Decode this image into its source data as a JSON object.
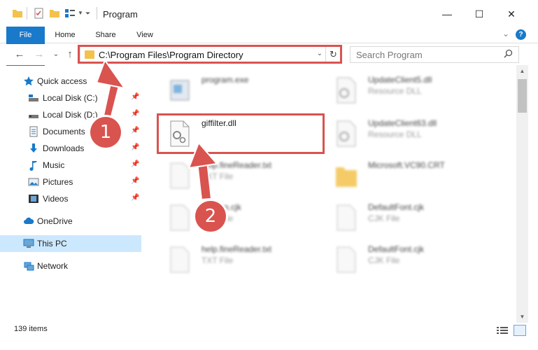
{
  "window": {
    "title": "Program",
    "minimize": "—",
    "maximize": "☐",
    "close": "✕"
  },
  "ribbon": {
    "tabs": [
      "File",
      "Home",
      "Share",
      "View"
    ],
    "help": "?"
  },
  "address": {
    "path": "C:\\Program Files\\Program Directory",
    "search_placeholder": "Search Program"
  },
  "sidebar": {
    "items": [
      {
        "label": "Quick access",
        "icon": "star-icon"
      },
      {
        "label": "Local Disk (C:)",
        "icon": "drive-icon"
      },
      {
        "label": "Local Disk (D:)",
        "icon": "drive-icon"
      },
      {
        "label": "Documents",
        "icon": "documents-icon"
      },
      {
        "label": "Downloads",
        "icon": "downloads-icon"
      },
      {
        "label": "Music",
        "icon": "music-icon"
      },
      {
        "label": "Pictures",
        "icon": "pictures-icon"
      },
      {
        "label": "Videos",
        "icon": "videos-icon"
      },
      {
        "label": "OneDrive",
        "icon": "cloud-icon"
      },
      {
        "label": "This PC",
        "icon": "computer-icon"
      },
      {
        "label": "Network",
        "icon": "network-icon"
      }
    ]
  },
  "files": [
    {
      "name": "program.exe",
      "sub": "",
      "icon": "exe-icon"
    },
    {
      "name": "UpdateClient5.dll",
      "sub": "Resource DLL",
      "icon": "dll-icon"
    },
    {
      "name": "giffilter.dll",
      "sub": "",
      "icon": "dll-icon"
    },
    {
      "name": "UpdateClient63.dll",
      "sub": "Resource DLL",
      "icon": "dll-icon"
    },
    {
      "name": "help.fineReader.txt",
      "sub": "TXT File",
      "icon": "txt-icon"
    },
    {
      "name": "Microsoft.VC90.CRT",
      "sub": "",
      "icon": "folder-icon"
    },
    {
      "name": "Korean.cjk",
      "sub": "CJK File",
      "icon": "file-icon"
    },
    {
      "name": "DefaultFont.cjk",
      "sub": "CJK File",
      "icon": "file-icon"
    },
    {
      "name": "help.fineReader.txt",
      "sub": "TXT File",
      "icon": "txt-icon"
    },
    {
      "name": "DefaultFont.cjk",
      "sub": "CJK File",
      "icon": "file-icon"
    }
  ],
  "status": {
    "item_count": "139 items"
  },
  "annotations": {
    "marker1": "1",
    "marker2": "2",
    "color": "#d9534f"
  },
  "colors": {
    "accent": "#1979ca",
    "selected": "#cce8ff",
    "folder": "#f3c24d"
  }
}
